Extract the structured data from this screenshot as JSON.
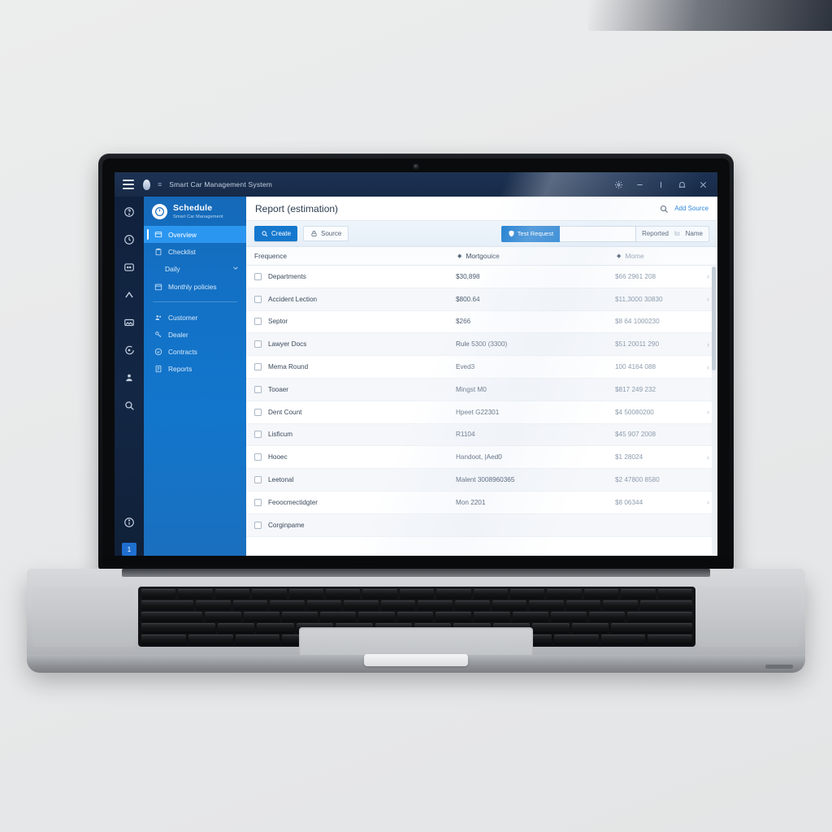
{
  "window": {
    "title": "Smart Car Management System",
    "controls": [
      {
        "name": "settings",
        "glyph": "settings-icon"
      },
      {
        "name": "minimize",
        "glyph": "minimize-icon"
      },
      {
        "name": "maximize",
        "glyph": "maximize-icon"
      },
      {
        "name": "notifications",
        "glyph": "bell-icon"
      },
      {
        "name": "close",
        "glyph": "close-icon"
      }
    ]
  },
  "rail": {
    "icons": [
      "help-circle-icon",
      "clock-circle-icon",
      "chat-box-icon",
      "chevron-up-icon",
      "image-icon",
      "message-icon",
      "users-icon",
      "search-icon"
    ],
    "bottom_icon": "info-icon",
    "badge": "1"
  },
  "sidebar": {
    "logo": "power-clock-icon",
    "title": "Schedule",
    "subtitle": "Smart Car Management",
    "items": [
      {
        "label": "Overview",
        "icon": "dashboard-icon",
        "active": true,
        "sub": false
      },
      {
        "label": "Checklist",
        "icon": "clipboard-icon",
        "active": false,
        "sub": false
      },
      {
        "label": "Daily",
        "icon": "",
        "active": false,
        "sub": true,
        "expander": "chevron-down-icon"
      },
      {
        "label": "Monthly policies",
        "icon": "calendar-icon",
        "active": false,
        "sub": false
      }
    ],
    "items2": [
      {
        "label": "Customer",
        "icon": "customer-icon"
      },
      {
        "label": "Dealer",
        "icon": "key-icon"
      },
      {
        "label": "Contracts",
        "icon": "contract-icon"
      },
      {
        "label": "Reports",
        "icon": "report-icon"
      }
    ]
  },
  "page": {
    "title": "Report (estimation)",
    "search_icon": "search-icon",
    "header_link": "Add Source"
  },
  "toolbar": {
    "primary_label": "Create",
    "primary_icon": "search-icon",
    "ghost_label": "Source",
    "ghost_icon": "lock-icon",
    "accent_label": "Test Request",
    "accent_icon": "shield-icon",
    "input_value": "",
    "input_placeholder": "",
    "filter_leading": "Reported",
    "filter_middle": "to",
    "filter_trailing": "Name"
  },
  "table": {
    "columns": [
      {
        "label": "Frequence",
        "sortable": false
      },
      {
        "label": "Mortgouice",
        "sortable": true,
        "sort_icon": "sort-icon"
      },
      {
        "label": "Mome",
        "sortable": true,
        "sort_icon": "sort-icon"
      }
    ],
    "rows": [
      {
        "name": "Departments",
        "value": "$30,898",
        "secondary": "$66 2961 208",
        "chevron": true
      },
      {
        "name": "Accident Lection",
        "value": "$800.64",
        "secondary": "$11,3000 30830",
        "chevron": true
      },
      {
        "name": "Septor",
        "value": "$266",
        "secondary": "$8 64 1000230",
        "chevron": false
      },
      {
        "name": "Lawyer Docs",
        "value": "Rule 5300 (3300)",
        "secondary": "$51 20011 290",
        "chevron": true
      },
      {
        "name": "Mema Round",
        "value": "Eved3",
        "secondary": "100 4164 088",
        "chevron": true
      },
      {
        "name": "Tooaer",
        "value": "Mingst M0",
        "secondary": "$817 249 232",
        "chevron": false
      },
      {
        "name": "Dent Count",
        "value": "Hpeet G22301",
        "secondary": "$4 50080200",
        "chevron": true
      },
      {
        "name": "Lisficum",
        "value": "R1104",
        "secondary": "$45 907 2008",
        "chevron": false
      },
      {
        "name": "Hooec",
        "value": "Handoot, |Aed0",
        "secondary": "$1 28024",
        "chevron": true
      },
      {
        "name": "Leetonal",
        "value": "Malent 3008960365",
        "secondary": "$2 47800 8580",
        "chevron": false
      },
      {
        "name": "Feoocmectidgter",
        "value": "Mon 2201",
        "secondary": "$8 06344",
        "chevron": true
      },
      {
        "name": "Corginpame",
        "value": "",
        "secondary": "",
        "chevron": false
      }
    ]
  },
  "colors": {
    "primary_blue": "#1578ce",
    "sidebar_blue": "#1276cc",
    "active_item_blue": "#2b96f0",
    "titlebar_navy": "#1d3253",
    "rail_navy": "#10213d",
    "link_blue": "#2f86df"
  }
}
